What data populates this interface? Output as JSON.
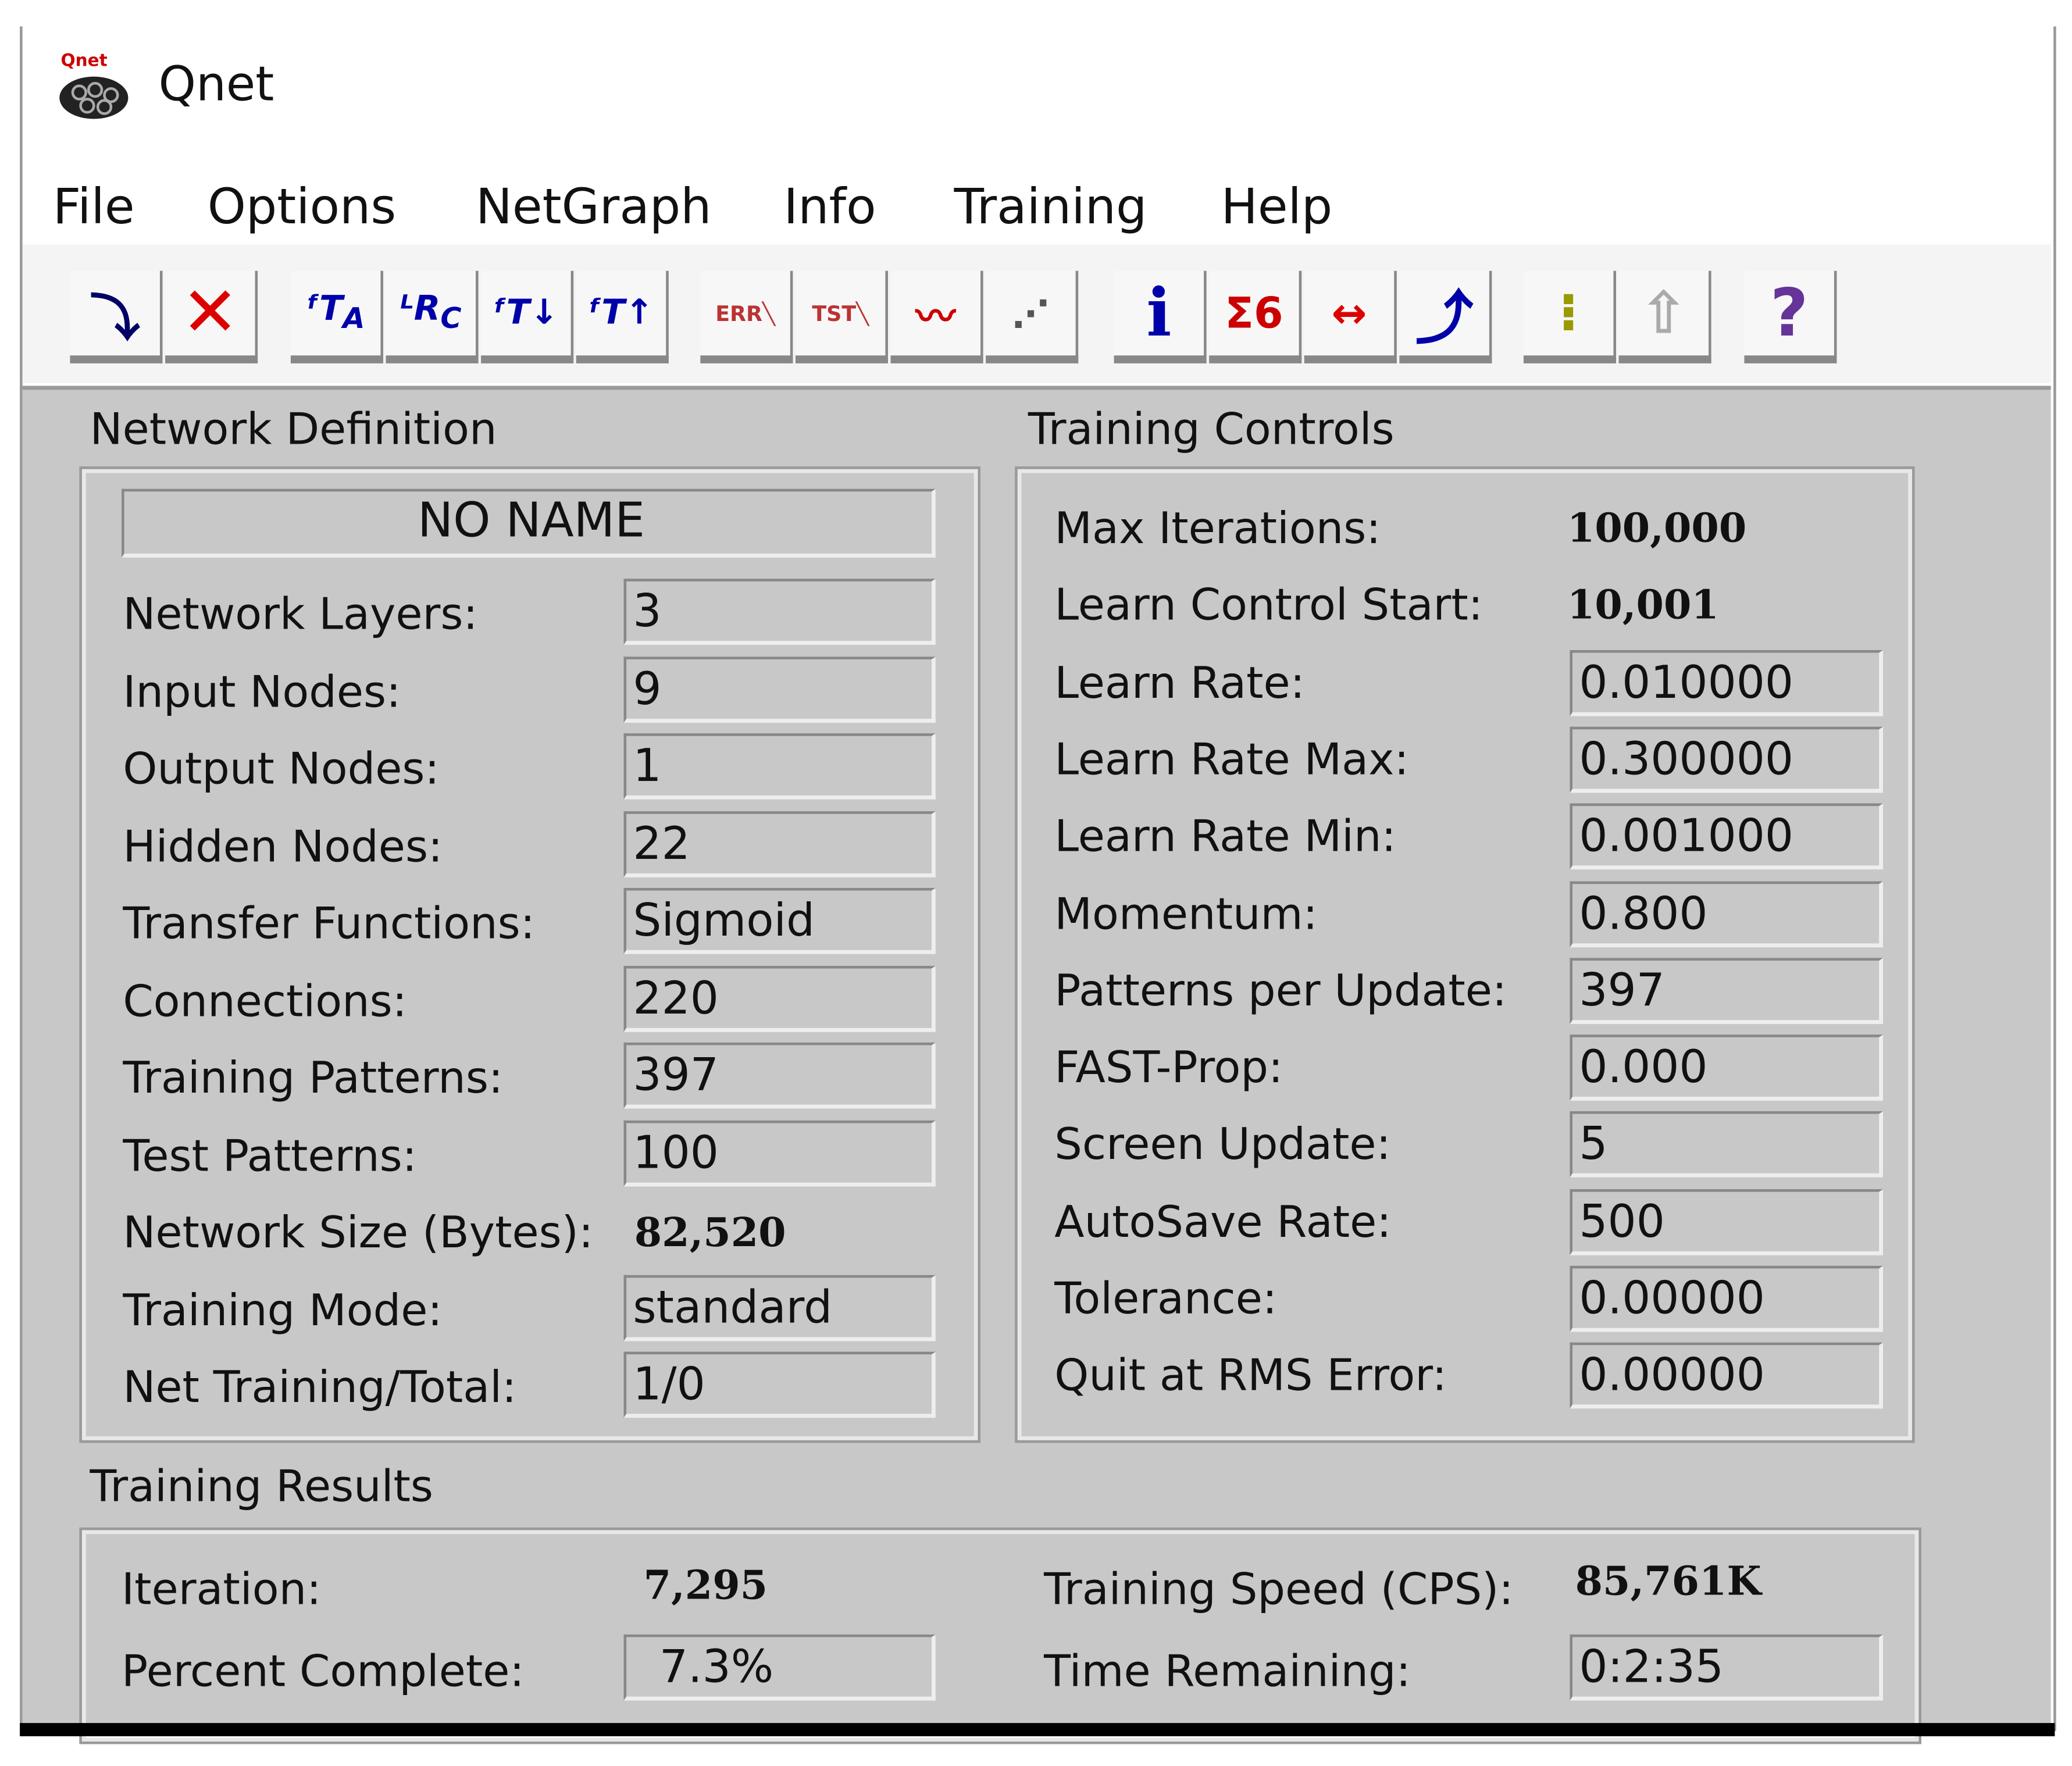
{
  "app": {
    "title": "Qnet",
    "logo_text": "Qnet"
  },
  "menu": [
    "File",
    "Options",
    "NetGraph",
    "Info",
    "Training",
    "Help"
  ],
  "toolbar": [
    "import-icon",
    "delete-icon",
    "ft-a-icon",
    "lr-c-icon",
    "ft-down-icon",
    "ft-up-icon",
    "err-graph-icon",
    "tst-graph-icon",
    "series-graph-icon",
    "scatter-graph-icon",
    "info-icon",
    "sigma-icon",
    "resize-arrows-icon",
    "return-arrow-icon",
    "traffic-light-icon",
    "up-arrow-disabled-icon",
    "help-icon"
  ],
  "network_definition": {
    "header": "Network Definition",
    "name": "NO NAME",
    "rows": [
      {
        "label": "Network Layers:",
        "value": "3"
      },
      {
        "label": "Input Nodes:",
        "value": "9"
      },
      {
        "label": "Output Nodes:",
        "value": "1"
      },
      {
        "label": "Hidden Nodes:",
        "value": "22"
      },
      {
        "label": "Transfer Functions:",
        "value": "Sigmoid"
      },
      {
        "label": "Connections:",
        "value": "220"
      },
      {
        "label": "Training Patterns:",
        "value": "397"
      },
      {
        "label": "Test Patterns:",
        "value": "100"
      },
      {
        "label": "Network Size (Bytes):",
        "value": "82,520"
      },
      {
        "label": "Training Mode:",
        "value": "standard"
      },
      {
        "label": "Net Training/Total:",
        "value": "1/0"
      }
    ]
  },
  "training_controls": {
    "header": "Training Controls",
    "rows": [
      {
        "label": "Max Iterations:",
        "value": "100,000"
      },
      {
        "label": "Learn Control Start:",
        "value": "10,001"
      },
      {
        "label": "Learn Rate:",
        "value": "0.010000"
      },
      {
        "label": "Learn Rate Max:",
        "value": "0.300000"
      },
      {
        "label": "Learn Rate Min:",
        "value": "0.001000"
      },
      {
        "label": "Momentum:",
        "value": "0.800"
      },
      {
        "label": "Patterns per Update:",
        "value": "397"
      },
      {
        "label": "FAST-Prop:",
        "value": "0.000"
      },
      {
        "label": "Screen Update:",
        "value": "5"
      },
      {
        "label": "AutoSave Rate:",
        "value": "500"
      },
      {
        "label": "Tolerance:",
        "value": "0.00000"
      },
      {
        "label": "Quit at RMS Error:",
        "value": "0.00000"
      }
    ]
  },
  "training_results": {
    "header": "Training Results",
    "iteration_label": "Iteration:",
    "iteration": "7,295",
    "percent_label": "Percent Complete:",
    "percent": "7.3%",
    "speed_label": "Training Speed (CPS):",
    "speed": "85,761K",
    "remaining_label": "Time Remaining:",
    "remaining": "0:2:35"
  }
}
